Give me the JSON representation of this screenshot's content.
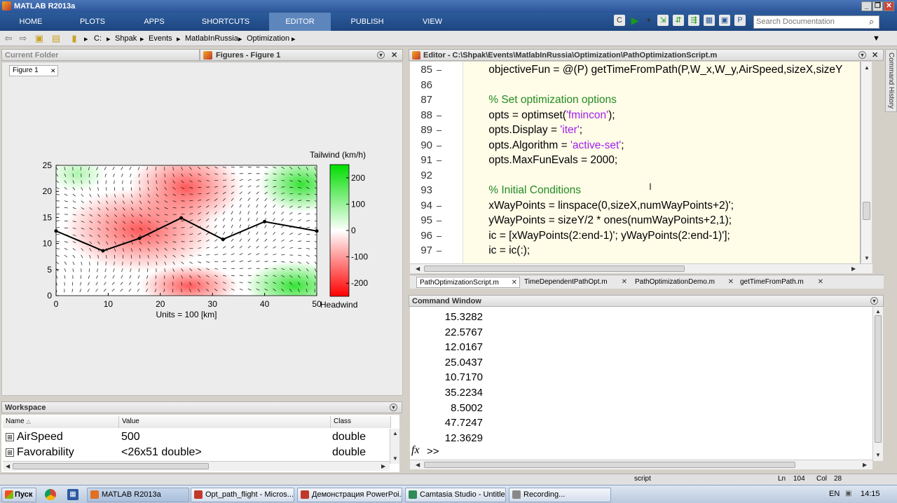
{
  "app": {
    "title": "MATLAB R2013a"
  },
  "ribbon": {
    "tabs": [
      {
        "label": "HOME"
      },
      {
        "label": "PLOTS"
      },
      {
        "label": "APPS"
      },
      {
        "label": "SHORTCUTS"
      },
      {
        "label": "EDITOR"
      },
      {
        "label": "PUBLISH"
      },
      {
        "label": "VIEW"
      }
    ],
    "active_tab": "EDITOR",
    "search_placeholder": "Search Documentation"
  },
  "address": {
    "crumbs": [
      "C:",
      "Shpak",
      "Events",
      "MatlabInRussia",
      "Optimization"
    ]
  },
  "current_folder": {
    "title": "Current Folder"
  },
  "figures": {
    "title": "Figures - Figure 1",
    "tab": "Figure 1"
  },
  "chart_data": {
    "type": "heatmap",
    "xlabel": "Units = 100 [km]",
    "x_ticks": [
      "0",
      "10",
      "20",
      "30",
      "40",
      "50"
    ],
    "y_ticks": [
      "0",
      "5",
      "10",
      "15",
      "20",
      "25"
    ],
    "xlim": [
      0,
      50
    ],
    "ylim": [
      0,
      25
    ],
    "colorbar": {
      "title": "Tailwind (km/h)",
      "bottom_label": "Headwind",
      "ticks": [
        "200",
        "100",
        "0",
        "-100",
        "-200"
      ],
      "range": [
        -250,
        250
      ],
      "colors": {
        "positive": "#00dd00",
        "zero": "#ffffff",
        "negative": "#ff0000"
      }
    },
    "path_points": [
      [
        0,
        12.4
      ],
      [
        9,
        8.6
      ],
      [
        16,
        11
      ],
      [
        24,
        14.9
      ],
      [
        32,
        10.8
      ],
      [
        40,
        14.2
      ],
      [
        50,
        12.4
      ]
    ]
  },
  "editor": {
    "title": "Editor - C:\\Shpak\\Events\\MatlabInRussia\\Optimization\\PathOptimizationScript.m",
    "lines": [
      {
        "num": "85",
        "dash": "–",
        "parts": [
          {
            "t": "    objectiveFun = @(P) getTimeFromPath(P,W_x,W_y,AirSpeed,sizeX,sizeY",
            "c": ""
          }
        ]
      },
      {
        "num": "86",
        "dash": "",
        "parts": []
      },
      {
        "num": "87",
        "dash": "",
        "parts": [
          {
            "t": "    % Set optimization options",
            "c": "cm"
          }
        ]
      },
      {
        "num": "88",
        "dash": "–",
        "parts": [
          {
            "t": "    opts = optimset(",
            "c": ""
          },
          {
            "t": "'fmincon'",
            "c": "str"
          },
          {
            "t": ");",
            "c": ""
          }
        ]
      },
      {
        "num": "89",
        "dash": "–",
        "parts": [
          {
            "t": "    opts.Display = ",
            "c": ""
          },
          {
            "t": "'iter'",
            "c": "str"
          },
          {
            "t": ";",
            "c": ""
          }
        ]
      },
      {
        "num": "90",
        "dash": "–",
        "parts": [
          {
            "t": "    opts.Algorithm = ",
            "c": ""
          },
          {
            "t": "'active-set'",
            "c": "str"
          },
          {
            "t": ";",
            "c": ""
          }
        ]
      },
      {
        "num": "91",
        "dash": "–",
        "parts": [
          {
            "t": "    opts.MaxFunEvals = 2000;",
            "c": ""
          }
        ]
      },
      {
        "num": "92",
        "dash": "",
        "parts": []
      },
      {
        "num": "93",
        "dash": "",
        "parts": [
          {
            "t": "    % Initial Conditions",
            "c": "cm"
          }
        ]
      },
      {
        "num": "94",
        "dash": "–",
        "parts": [
          {
            "t": "    xWayPoints = linspace(0,sizeX,numWayPoints+2)';",
            "c": ""
          }
        ]
      },
      {
        "num": "95",
        "dash": "–",
        "parts": [
          {
            "t": "    yWayPoints = sizeY/2 * ones(numWayPoints+2,1);",
            "c": ""
          }
        ]
      },
      {
        "num": "96",
        "dash": "–",
        "parts": [
          {
            "t": "    ic = [xWayPoints(2:end-1)'; yWayPoints(2:end-1)'];",
            "c": ""
          }
        ]
      },
      {
        "num": "97",
        "dash": "–",
        "parts": [
          {
            "t": "    ic = ic(:);",
            "c": ""
          }
        ]
      }
    ],
    "tabs": [
      {
        "label": "PathOptimizationScript.m"
      },
      {
        "label": "TimeDependentPathOpt.m"
      },
      {
        "label": "PathOptimizationDemo.m"
      },
      {
        "label": "getTimeFromPath.m"
      }
    ]
  },
  "command_window": {
    "title": "Command Window",
    "output": [
      "15.3282",
      "22.5767",
      "12.0167",
      "25.0437",
      "10.7170",
      "35.2234",
      "8.5002",
      "47.7247",
      "12.3629"
    ],
    "fx": "fx",
    "prompt": ">>"
  },
  "workspace": {
    "title": "Workspace",
    "columns": [
      "Name",
      "Value",
      "Class"
    ],
    "rows": [
      {
        "name": "AirSpeed",
        "value": "500",
        "class": "double"
      },
      {
        "name": "Favorability",
        "value": "<26x51 double>",
        "class": "double"
      }
    ]
  },
  "status": {
    "mode": "script",
    "ln_label": "Ln",
    "ln": "104",
    "col_label": "Col",
    "col": "28"
  },
  "side_tab": "Command History",
  "taskbar": {
    "start": "Пуск",
    "items": [
      {
        "label": "MATLAB R2013a",
        "color": "#e07020"
      },
      {
        "label": "Opt_path_flight - Micros...",
        "color": "#c0392b"
      },
      {
        "label": "Демонстрация PowerPoi...",
        "color": "#c0392b"
      },
      {
        "label": "Camtasia Studio - Untitle...",
        "color": "#2e8b57"
      },
      {
        "label": "Recording...",
        "color": "#888888"
      }
    ],
    "lang": "EN",
    "time": "14:15"
  }
}
